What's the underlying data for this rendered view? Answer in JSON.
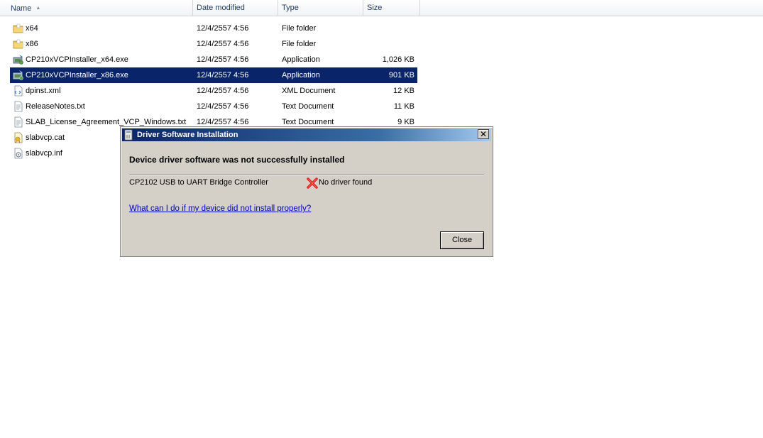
{
  "columns": {
    "name": "Name",
    "date": "Date modified",
    "type": "Type",
    "size": "Size"
  },
  "files": [
    {
      "name": "x64",
      "date": "12/4/2557 4:56",
      "type": "File folder",
      "size": "",
      "icon": "folder-icon"
    },
    {
      "name": "x86",
      "date": "12/4/2557 4:56",
      "type": "File folder",
      "size": "",
      "icon": "folder-icon"
    },
    {
      "name": "CP210xVCPInstaller_x64.exe",
      "date": "12/4/2557 4:56",
      "type": "Application",
      "size": "1,026 KB",
      "icon": "installer-icon"
    },
    {
      "name": "CP210xVCPInstaller_x86.exe",
      "date": "12/4/2557 4:56",
      "type": "Application",
      "size": "901 KB",
      "icon": "installer-icon",
      "selected": true
    },
    {
      "name": "dpinst.xml",
      "date": "12/4/2557 4:56",
      "type": "XML Document",
      "size": "12 KB",
      "icon": "xml-file-icon"
    },
    {
      "name": "ReleaseNotes.txt",
      "date": "12/4/2557 4:56",
      "type": "Text Document",
      "size": "11 KB",
      "icon": "text-file-icon"
    },
    {
      "name": "SLAB_License_Agreement_VCP_Windows.txt",
      "date": "12/4/2557 4:56",
      "type": "Text Document",
      "size": "9 KB",
      "icon": "text-file-icon"
    },
    {
      "name": "slabvcp.cat",
      "date": "",
      "type": "",
      "size": "",
      "icon": "catalog-file-icon"
    },
    {
      "name": "slabvcp.inf",
      "date": "",
      "type": "",
      "size": "",
      "icon": "setup-info-file-icon"
    }
  ],
  "dialog": {
    "title": "Driver Software Installation",
    "heading": "Device driver software was not successfully installed",
    "device_name": "CP2102 USB to UART Bridge Controller",
    "status": "No driver found",
    "help_link": "What can I do if my device did not install properly?",
    "close_label": "Close",
    "close_glyph": "✕"
  },
  "colors": {
    "selection": "#0a246a",
    "dialog_face": "#d4d0c8",
    "link": "#0000cc",
    "error_red": "#e01818"
  }
}
